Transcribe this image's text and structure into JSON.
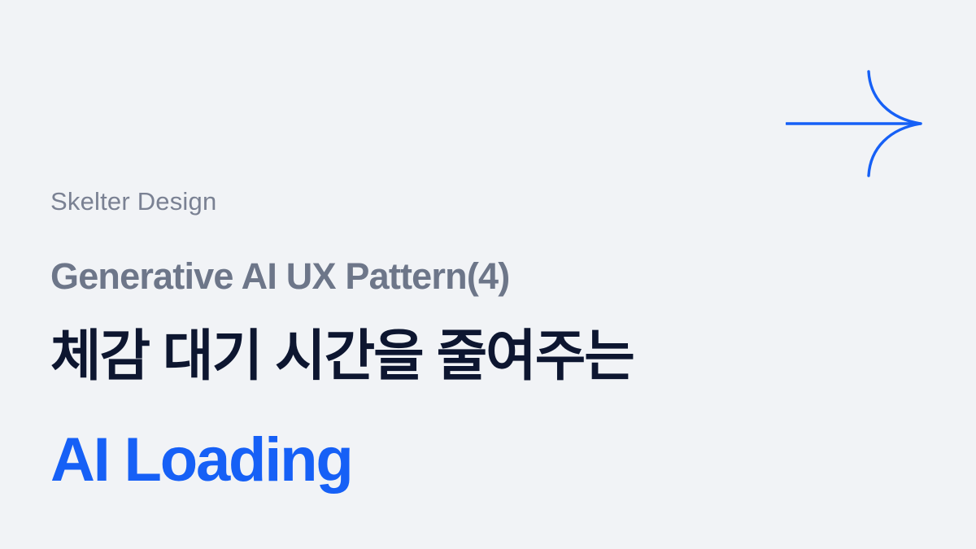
{
  "brand": "Skelter Design",
  "subtitle": "Generative AI UX Pattern(4)",
  "title_ko": "체감 대기 시간을 줄여주는",
  "title_en": "AI Loading",
  "icons": {
    "arrow": "arrow-right-icon"
  },
  "colors": {
    "background": "#f1f3f6",
    "brand": "#7a8193",
    "subtitle": "#6d7689",
    "title_ko": "#0d1630",
    "accent": "#1660f6"
  }
}
